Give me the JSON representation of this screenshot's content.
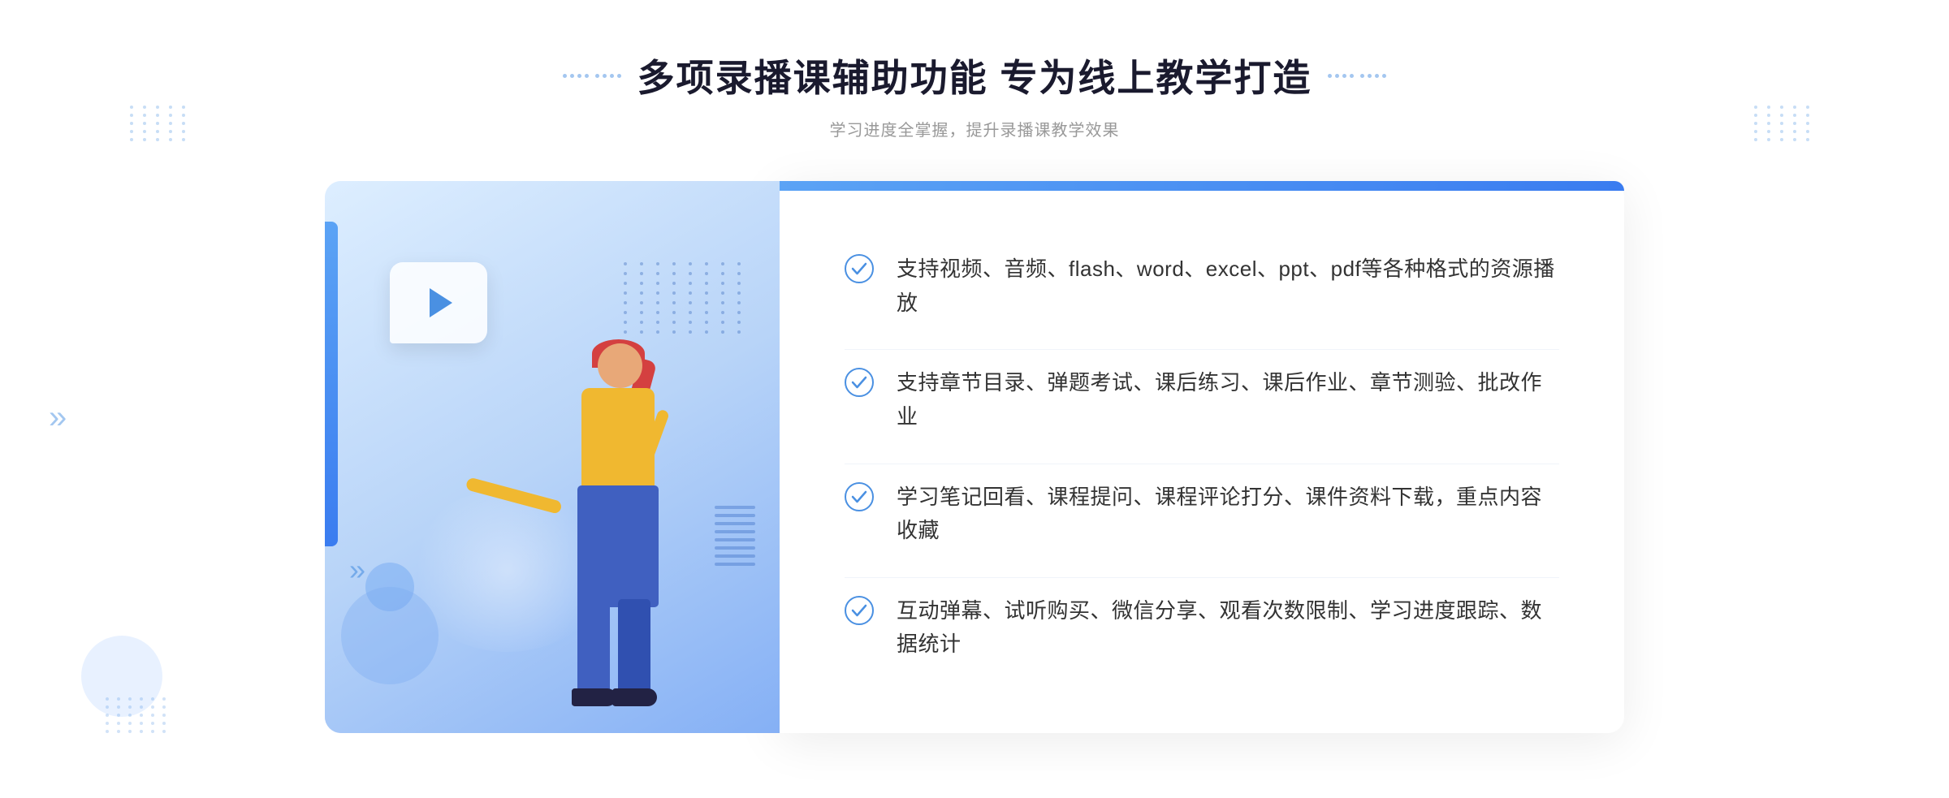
{
  "header": {
    "title": "多项录播课辅助功能 专为线上教学打造",
    "subtitle": "学习进度全掌握，提升录播课教学效果",
    "title_decoration_left": "···",
    "title_decoration_right": "···"
  },
  "features": [
    {
      "id": 1,
      "text": "支持视频、音频、flash、word、excel、ppt、pdf等各种格式的资源播放"
    },
    {
      "id": 2,
      "text": "支持章节目录、弹题考试、课后练习、课后作业、章节测验、批改作业"
    },
    {
      "id": 3,
      "text": "学习笔记回看、课程提问、课程评论打分、课件资料下载，重点内容收藏"
    },
    {
      "id": 4,
      "text": "互动弹幕、试听购买、微信分享、观看次数限制、学习进度跟踪、数据统计"
    }
  ]
}
